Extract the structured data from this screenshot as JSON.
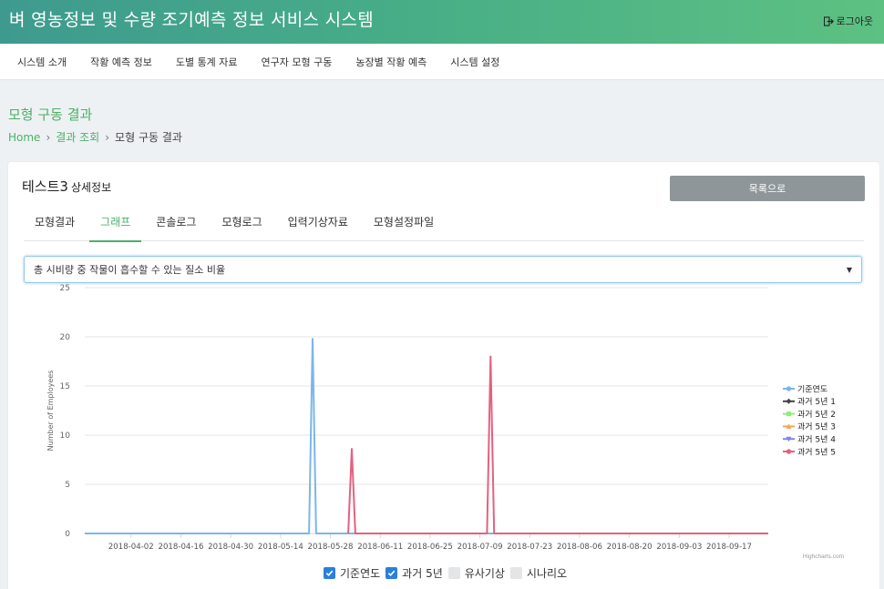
{
  "header": {
    "title": "벼 영농정보 및 수량 조기예측 정보 서비스 시스템",
    "logout_label": "로그아웃"
  },
  "nav": [
    "시스템 소개",
    "작황 예측 정보",
    "도별 통계 자료",
    "연구자 모형 구동",
    "농장별 작황 예측",
    "시스템 설정"
  ],
  "page": {
    "title": "모형 구동 결과",
    "breadcrumb": [
      "Home",
      "결과 조회",
      "모형 구동 결과"
    ]
  },
  "detail": {
    "name": "테스트3",
    "suffix": "상세정보",
    "list_button": "목록으로",
    "tabs": [
      "모형결과",
      "그래프",
      "콘솔로그",
      "모형로그",
      "입력기상자료",
      "모형설정파일"
    ],
    "active_tab": 1,
    "select_value": "총 시비량 중 작물이 흡수할 수 있는 질소 비율"
  },
  "filters": [
    {
      "label": "기준연도",
      "checked": true
    },
    {
      "label": "과거 5년",
      "checked": true
    },
    {
      "label": "유사기상",
      "checked": false
    },
    {
      "label": "시나리오",
      "checked": false
    }
  ],
  "colors": {
    "accent": "#4caf6a",
    "checkbox": "#2a7ee0"
  },
  "chart_data": {
    "type": "line",
    "ylabel": "Number of Employees",
    "ylim": [
      0,
      25
    ],
    "y_ticks": [
      0,
      5,
      10,
      15,
      20,
      25
    ],
    "x_range": [
      "2018-03-20",
      "2018-09-28"
    ],
    "x_ticks": [
      "2018-04-02",
      "2018-04-16",
      "2018-04-30",
      "2018-05-14",
      "2018-05-28",
      "2018-06-11",
      "2018-06-25",
      "2018-07-09",
      "2018-07-23",
      "2018-08-06",
      "2018-08-20",
      "2018-09-03",
      "2018-09-17"
    ],
    "legend_position": "right",
    "credit": "Highcharts.com",
    "series": [
      {
        "name": "기준연도",
        "color": "#7cb5ec",
        "marker": "circle",
        "points": [
          [
            "2018-03-20",
            0
          ],
          [
            "2018-05-22",
            0
          ],
          [
            "2018-05-23",
            19.8
          ],
          [
            "2018-05-24",
            0
          ],
          [
            "2018-09-28",
            0
          ]
        ]
      },
      {
        "name": "과거 5년 1",
        "color": "#434348",
        "marker": "diamond",
        "points": []
      },
      {
        "name": "과거 5년 2",
        "color": "#90ed7d",
        "marker": "square",
        "points": []
      },
      {
        "name": "과거 5년 3",
        "color": "#f7a35c",
        "marker": "triangle",
        "points": []
      },
      {
        "name": "과거 5년 4",
        "color": "#8085e9",
        "marker": "triangle-down",
        "points": []
      },
      {
        "name": "과거 5년 5",
        "color": "#e4617f",
        "marker": "circle",
        "points": [
          [
            "2018-06-02",
            0
          ],
          [
            "2018-06-03",
            8.6
          ],
          [
            "2018-06-04",
            0
          ],
          [
            "2018-07-11",
            0
          ],
          [
            "2018-07-12",
            18
          ],
          [
            "2018-07-13",
            0
          ],
          [
            "2018-09-28",
            0
          ]
        ]
      }
    ]
  }
}
